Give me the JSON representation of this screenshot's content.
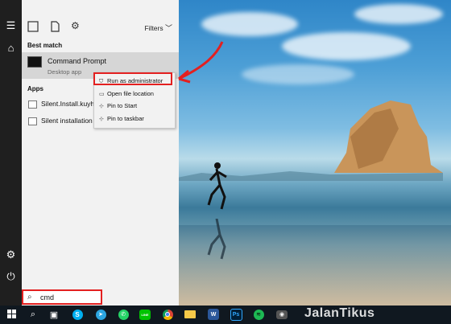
{
  "start_menu": {
    "filters_label": "Filters",
    "best_match_heading": "Best match",
    "best_match": {
      "title": "Command Prompt",
      "subtitle": "Desktop app"
    },
    "apps_heading": "Apps",
    "apps": [
      {
        "label": "Silent.Install.kuyhA"
      },
      {
        "label": "Silent installation"
      }
    ]
  },
  "context_menu": {
    "items": [
      {
        "label": "Run as administrator",
        "icon": "shield-icon"
      },
      {
        "label": "Open file location",
        "icon": "folder-icon"
      },
      {
        "label": "Pin to Start",
        "icon": "pin-icon"
      },
      {
        "label": "Pin to taskbar",
        "icon": "pin-icon"
      }
    ]
  },
  "search": {
    "value": "cmd"
  },
  "taskbar": {
    "icons": [
      "windows-icon",
      "search-icon",
      "task-view-icon",
      "skype-icon",
      "telegram-icon",
      "whatsapp-icon",
      "line-icon",
      "chrome-icon",
      "file-explorer-icon",
      "word-icon",
      "photoshop-icon",
      "spotify-icon",
      "camera-icon"
    ],
    "app_labels": {
      "word": "W",
      "photoshop": "Ps",
      "line": "LINE"
    }
  },
  "watermark": "JalanTikus",
  "colors": {
    "highlight": "#e32020",
    "rail": "#1f1f1f",
    "taskbar": "#101820"
  }
}
